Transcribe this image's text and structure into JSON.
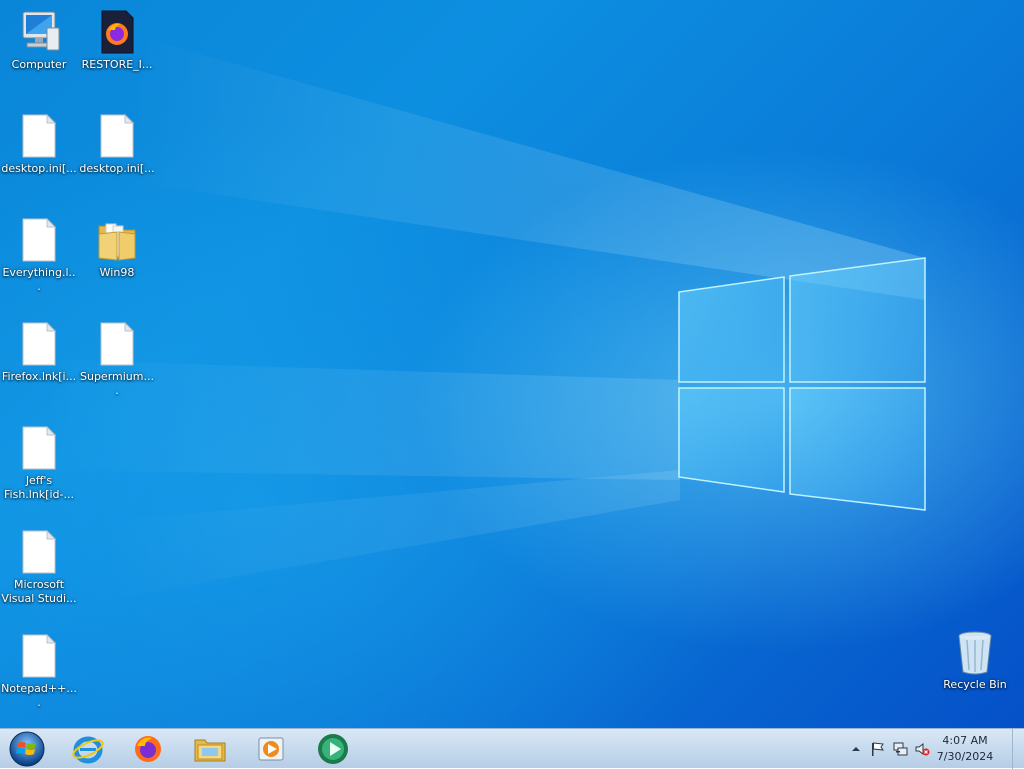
{
  "desktop": {
    "icons": [
      {
        "label": "Computer",
        "icon": "computer-icon"
      },
      {
        "label": "RESTORE_I...",
        "icon": "firefox-file-icon"
      },
      {
        "label": "desktop.ini[...",
        "icon": "file-icon"
      },
      {
        "label": "desktop.ini[...",
        "icon": "file-icon"
      },
      {
        "label": "Everything.l...",
        "icon": "file-icon"
      },
      {
        "label": "Win98",
        "icon": "folder-icon"
      },
      {
        "label": "Firefox.lnk[i...",
        "icon": "file-icon"
      },
      {
        "label": "Supermium....",
        "icon": "file-icon"
      },
      {
        "label": "Jeff's Fish.lnk[id-...",
        "icon": "file-icon"
      },
      {
        "label": "Microsoft Visual Studi...",
        "icon": "file-icon"
      },
      {
        "label": "Notepad++....",
        "icon": "file-icon"
      },
      {
        "label": "Recycle Bin",
        "icon": "recycle-bin-icon"
      }
    ]
  },
  "taskbar": {
    "pinned": [
      {
        "name": "start-orb",
        "icon": "windows-logo-icon"
      },
      {
        "name": "internet-explorer",
        "icon": "internet-explorer-icon"
      },
      {
        "name": "firefox",
        "icon": "firefox-icon"
      },
      {
        "name": "file-explorer",
        "icon": "folder-icon"
      },
      {
        "name": "media-player",
        "icon": "media-player-icon"
      },
      {
        "name": "media-center",
        "icon": "media-center-icon"
      }
    ],
    "tray": {
      "icons": [
        "show-hidden-icons-icon",
        "action-center-flag-icon",
        "network-icon",
        "volume-muted-icon"
      ],
      "time": "4:07 AM",
      "date": "7/30/2024"
    }
  },
  "colors": {
    "wallpaper_base": "#0a86d8",
    "taskbar": "#c9dcef",
    "clock_text": "#1b2a3d"
  }
}
